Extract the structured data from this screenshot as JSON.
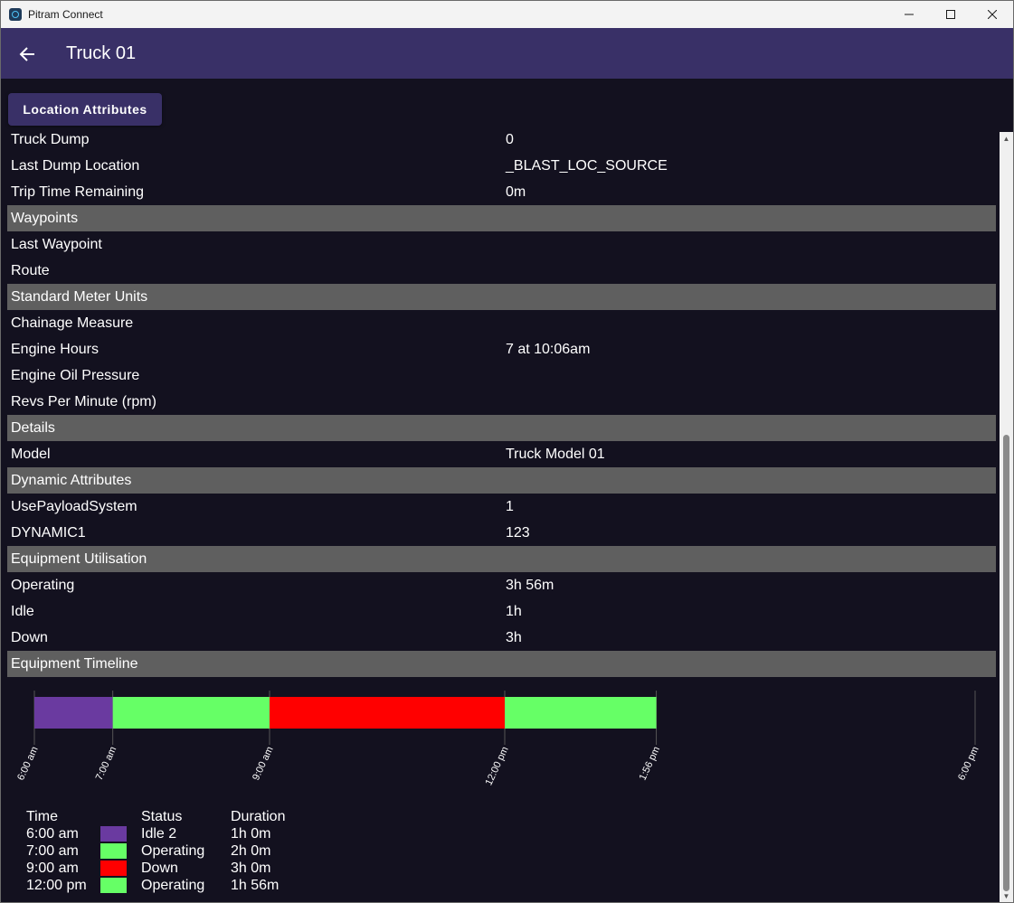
{
  "window": {
    "title": "Pitram Connect"
  },
  "header": {
    "title": "Truck 01"
  },
  "tab": {
    "label": "Location Attributes"
  },
  "rows": [
    {
      "type": "item",
      "label": "Truck Dump",
      "value": "0"
    },
    {
      "type": "item",
      "label": "Last Dump Location",
      "value": "_BLAST_LOC_SOURCE"
    },
    {
      "type": "item",
      "label": "Trip Time Remaining",
      "value": "0m"
    },
    {
      "type": "section",
      "label": "Waypoints",
      "value": ""
    },
    {
      "type": "item",
      "label": "Last Waypoint",
      "value": ""
    },
    {
      "type": "item",
      "label": "Route",
      "value": ""
    },
    {
      "type": "section",
      "label": "Standard Meter Units",
      "value": ""
    },
    {
      "type": "item",
      "label": "Chainage Measure",
      "value": ""
    },
    {
      "type": "item",
      "label": "Engine Hours",
      "value": "7 at 10:06am"
    },
    {
      "type": "item",
      "label": "Engine Oil Pressure",
      "value": ""
    },
    {
      "type": "item",
      "label": "Revs Per Minute (rpm)",
      "value": ""
    },
    {
      "type": "section",
      "label": "Details",
      "value": ""
    },
    {
      "type": "item",
      "label": "Model",
      "value": "Truck Model 01"
    },
    {
      "type": "section",
      "label": "Dynamic Attributes",
      "value": ""
    },
    {
      "type": "item",
      "label": "UsePayloadSystem",
      "value": "1"
    },
    {
      "type": "item",
      "label": "DYNAMIC1",
      "value": "123"
    },
    {
      "type": "section",
      "label": "Equipment Utilisation",
      "value": ""
    },
    {
      "type": "item",
      "label": "Operating",
      "value": "3h 56m"
    },
    {
      "type": "item",
      "label": "Idle",
      "value": "1h"
    },
    {
      "type": "item",
      "label": "Down",
      "value": "3h"
    },
    {
      "type": "section",
      "label": "Equipment Timeline",
      "value": ""
    }
  ],
  "chart_data": {
    "type": "bar",
    "orientation": "horizontal-timeline",
    "x_unit": "hours of day",
    "xlim": [
      6,
      18
    ],
    "ticks": [
      {
        "label": "6:00 am",
        "hour": 6
      },
      {
        "label": "7:00 am",
        "hour": 7
      },
      {
        "label": "9:00 am",
        "hour": 9
      },
      {
        "label": "12:00 pm",
        "hour": 12
      },
      {
        "label": "1:56 pm",
        "hour": 13.9333
      },
      {
        "label": "6:00 pm",
        "hour": 18
      }
    ],
    "segments": [
      {
        "start": 6,
        "end": 7,
        "status": "Idle 2",
        "color": "#6a3aa0"
      },
      {
        "start": 7,
        "end": 9,
        "status": "Operating",
        "color": "#66ff66"
      },
      {
        "start": 9,
        "end": 12,
        "status": "Down",
        "color": "#ff0000"
      },
      {
        "start": 12,
        "end": 13.9333,
        "status": "Operating",
        "color": "#66ff66"
      }
    ]
  },
  "legend": {
    "headers": {
      "time": "Time",
      "status": "Status",
      "duration": "Duration"
    },
    "entries": [
      {
        "time": "6:00 am",
        "status": "Idle 2",
        "duration": "1h 0m",
        "color": "#6a3aa0"
      },
      {
        "time": "7:00 am",
        "status": "Operating",
        "duration": "2h 0m",
        "color": "#66ff66"
      },
      {
        "time": "9:00 am",
        "status": "Down",
        "duration": "3h 0m",
        "color": "#ff0000"
      },
      {
        "time": "12:00 pm",
        "status": "Operating",
        "duration": "1h 56m",
        "color": "#66ff66"
      }
    ]
  }
}
